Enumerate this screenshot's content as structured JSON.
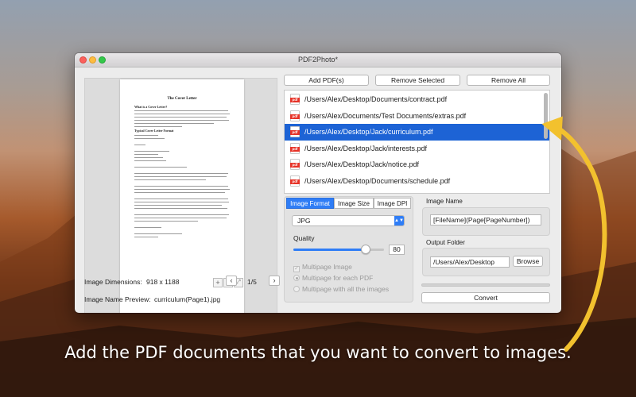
{
  "window": {
    "title": "PDF2Photo*"
  },
  "preview": {
    "doc_title": "The Cover Letter",
    "doc_heading_1": "What is a Cover Letter?",
    "doc_heading_2": "Typical Cover Letter Format",
    "dimensions_label": "Image Dimensions:",
    "dimensions_value": "918 x 1188",
    "page_indicator": "1/5",
    "prev_label": "‹",
    "next_label": "›",
    "name_preview_label": "Image Name Preview:",
    "name_preview_value": "curriculum(Page1).jpg",
    "zoom_in": "+",
    "zoom_out": "−",
    "fit": "⤢"
  },
  "toolbar": {
    "add_label": "Add PDF(s)",
    "remove_selected_label": "Remove Selected",
    "remove_all_label": "Remove All"
  },
  "files": [
    {
      "icon_text": "pdf",
      "path": "/Users/Alex/Desktop/Documents/contract.pdf",
      "selected": false
    },
    {
      "icon_text": "pdf",
      "path": "/Users/Alex/Documents/Test Documents/extras.pdf",
      "selected": false
    },
    {
      "icon_text": "pdf",
      "path": "/Users/Alex/Desktop/Jack/curriculum.pdf",
      "selected": true
    },
    {
      "icon_text": "pdf",
      "path": "/Users/Alex/Desktop/Jack/interests.pdf",
      "selected": false
    },
    {
      "icon_text": "pdf",
      "path": "/Users/Alex/Desktop/Jack/notice.pdf",
      "selected": false
    },
    {
      "icon_text": "pdf",
      "path": "/Users/Alex/Desktop/Documents/schedule.pdf",
      "selected": false
    }
  ],
  "settings": {
    "tabs": [
      "Image Format",
      "Image Size",
      "Image DPI"
    ],
    "active_tab": "Image Format",
    "format_value": "JPG",
    "quality_label": "Quality",
    "quality_value": "80",
    "quality_fraction": 0.8,
    "multipage_label": "Multipage Image",
    "option_each_pdf": "Multipage for each PDF",
    "option_all_images": "Multipage with all the images"
  },
  "image_name": {
    "label": "Image Name",
    "value": "[FileName](Page[PageNumber])"
  },
  "output": {
    "label": "Output Folder",
    "value": "/Users/Alex/Desktop",
    "browse_label": "Browse"
  },
  "convert_label": "Convert",
  "caption": "Add the PDF documents that you want to convert to images.",
  "colors": {
    "accent": "#2f7df6",
    "selection": "#1d63d5",
    "arrow": "#f2c12e"
  }
}
